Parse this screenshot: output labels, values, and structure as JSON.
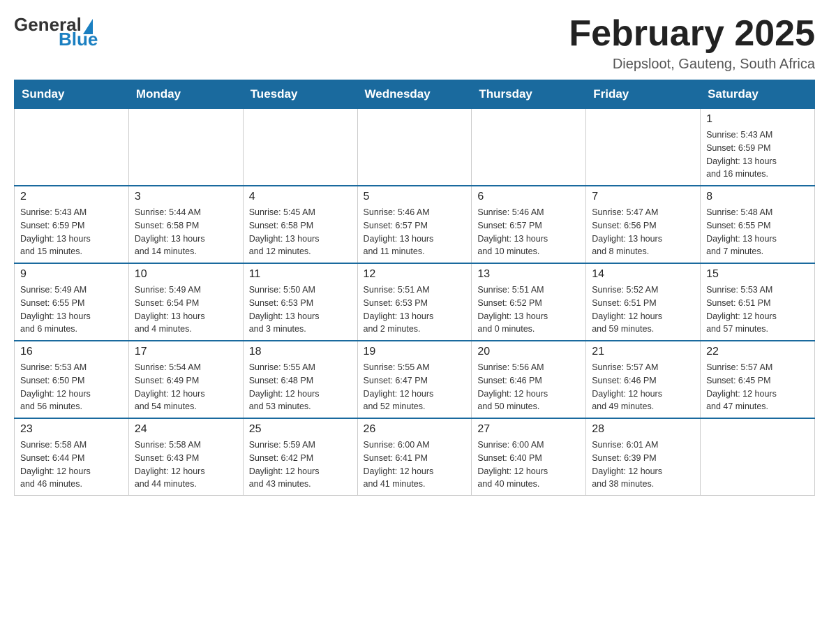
{
  "header": {
    "title": "February 2025",
    "location": "Diepsloot, Gauteng, South Africa"
  },
  "logo": {
    "general": "General",
    "arrow": "▲",
    "blue": "Blue"
  },
  "days": [
    "Sunday",
    "Monday",
    "Tuesday",
    "Wednesday",
    "Thursday",
    "Friday",
    "Saturday"
  ],
  "weeks": [
    [
      {
        "date": "",
        "info": ""
      },
      {
        "date": "",
        "info": ""
      },
      {
        "date": "",
        "info": ""
      },
      {
        "date": "",
        "info": ""
      },
      {
        "date": "",
        "info": ""
      },
      {
        "date": "",
        "info": ""
      },
      {
        "date": "1",
        "info": "Sunrise: 5:43 AM\nSunset: 6:59 PM\nDaylight: 13 hours\nand 16 minutes."
      }
    ],
    [
      {
        "date": "2",
        "info": "Sunrise: 5:43 AM\nSunset: 6:59 PM\nDaylight: 13 hours\nand 15 minutes."
      },
      {
        "date": "3",
        "info": "Sunrise: 5:44 AM\nSunset: 6:58 PM\nDaylight: 13 hours\nand 14 minutes."
      },
      {
        "date": "4",
        "info": "Sunrise: 5:45 AM\nSunset: 6:58 PM\nDaylight: 13 hours\nand 12 minutes."
      },
      {
        "date": "5",
        "info": "Sunrise: 5:46 AM\nSunset: 6:57 PM\nDaylight: 13 hours\nand 11 minutes."
      },
      {
        "date": "6",
        "info": "Sunrise: 5:46 AM\nSunset: 6:57 PM\nDaylight: 13 hours\nand 10 minutes."
      },
      {
        "date": "7",
        "info": "Sunrise: 5:47 AM\nSunset: 6:56 PM\nDaylight: 13 hours\nand 8 minutes."
      },
      {
        "date": "8",
        "info": "Sunrise: 5:48 AM\nSunset: 6:55 PM\nDaylight: 13 hours\nand 7 minutes."
      }
    ],
    [
      {
        "date": "9",
        "info": "Sunrise: 5:49 AM\nSunset: 6:55 PM\nDaylight: 13 hours\nand 6 minutes."
      },
      {
        "date": "10",
        "info": "Sunrise: 5:49 AM\nSunset: 6:54 PM\nDaylight: 13 hours\nand 4 minutes."
      },
      {
        "date": "11",
        "info": "Sunrise: 5:50 AM\nSunset: 6:53 PM\nDaylight: 13 hours\nand 3 minutes."
      },
      {
        "date": "12",
        "info": "Sunrise: 5:51 AM\nSunset: 6:53 PM\nDaylight: 13 hours\nand 2 minutes."
      },
      {
        "date": "13",
        "info": "Sunrise: 5:51 AM\nSunset: 6:52 PM\nDaylight: 13 hours\nand 0 minutes."
      },
      {
        "date": "14",
        "info": "Sunrise: 5:52 AM\nSunset: 6:51 PM\nDaylight: 12 hours\nand 59 minutes."
      },
      {
        "date": "15",
        "info": "Sunrise: 5:53 AM\nSunset: 6:51 PM\nDaylight: 12 hours\nand 57 minutes."
      }
    ],
    [
      {
        "date": "16",
        "info": "Sunrise: 5:53 AM\nSunset: 6:50 PM\nDaylight: 12 hours\nand 56 minutes."
      },
      {
        "date": "17",
        "info": "Sunrise: 5:54 AM\nSunset: 6:49 PM\nDaylight: 12 hours\nand 54 minutes."
      },
      {
        "date": "18",
        "info": "Sunrise: 5:55 AM\nSunset: 6:48 PM\nDaylight: 12 hours\nand 53 minutes."
      },
      {
        "date": "19",
        "info": "Sunrise: 5:55 AM\nSunset: 6:47 PM\nDaylight: 12 hours\nand 52 minutes."
      },
      {
        "date": "20",
        "info": "Sunrise: 5:56 AM\nSunset: 6:46 PM\nDaylight: 12 hours\nand 50 minutes."
      },
      {
        "date": "21",
        "info": "Sunrise: 5:57 AM\nSunset: 6:46 PM\nDaylight: 12 hours\nand 49 minutes."
      },
      {
        "date": "22",
        "info": "Sunrise: 5:57 AM\nSunset: 6:45 PM\nDaylight: 12 hours\nand 47 minutes."
      }
    ],
    [
      {
        "date": "23",
        "info": "Sunrise: 5:58 AM\nSunset: 6:44 PM\nDaylight: 12 hours\nand 46 minutes."
      },
      {
        "date": "24",
        "info": "Sunrise: 5:58 AM\nSunset: 6:43 PM\nDaylight: 12 hours\nand 44 minutes."
      },
      {
        "date": "25",
        "info": "Sunrise: 5:59 AM\nSunset: 6:42 PM\nDaylight: 12 hours\nand 43 minutes."
      },
      {
        "date": "26",
        "info": "Sunrise: 6:00 AM\nSunset: 6:41 PM\nDaylight: 12 hours\nand 41 minutes."
      },
      {
        "date": "27",
        "info": "Sunrise: 6:00 AM\nSunset: 6:40 PM\nDaylight: 12 hours\nand 40 minutes."
      },
      {
        "date": "28",
        "info": "Sunrise: 6:01 AM\nSunset: 6:39 PM\nDaylight: 12 hours\nand 38 minutes."
      },
      {
        "date": "",
        "info": ""
      }
    ]
  ]
}
